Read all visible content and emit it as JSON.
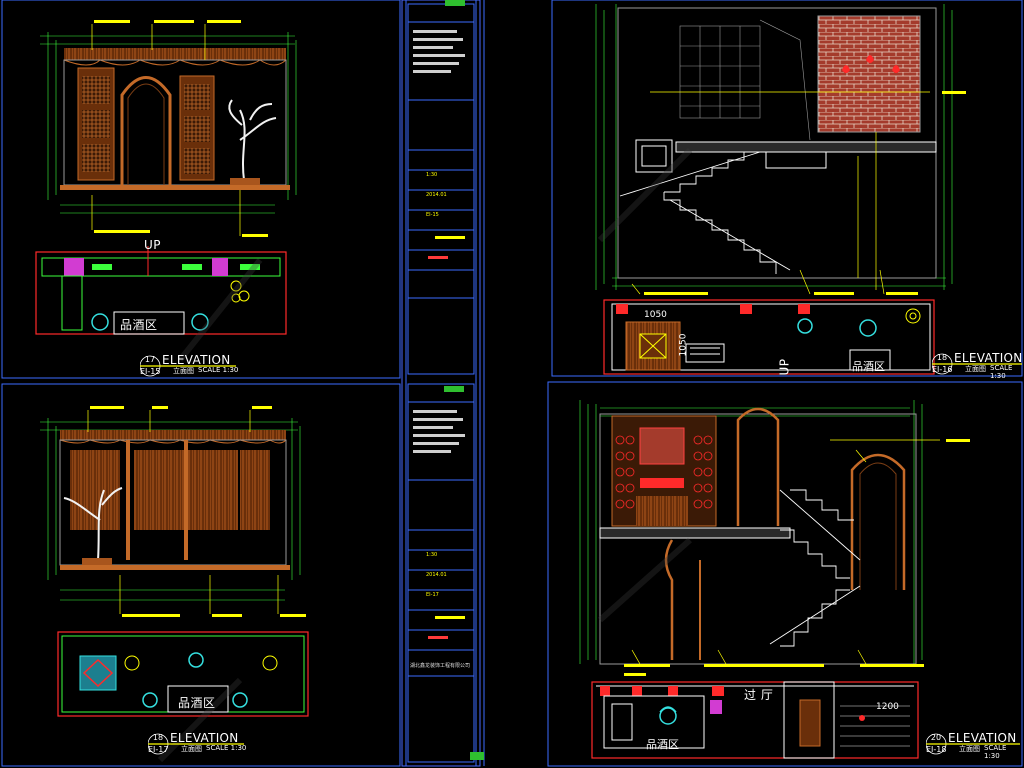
{
  "panels": [
    {
      "id": "tl",
      "up_label": "UP",
      "plan_label": "品酒区",
      "tag": {
        "number": "17",
        "title": "ELEVATION",
        "code": "EI-15",
        "cn": "立面图",
        "scale": "SCALE  1:30"
      }
    },
    {
      "id": "tr",
      "up_label": "UP",
      "plan_label": "品酒区",
      "dim_a": "1050",
      "dim_b": "1050",
      "tag": {
        "number": "18",
        "title": "ELEVATION",
        "code": "EI-16",
        "cn": "立面图",
        "scale": "SCALE  1:30"
      }
    },
    {
      "id": "bl",
      "plan_label": "品酒区",
      "tag": {
        "number": "18",
        "title": "ELEVATION",
        "code": "EI-17",
        "cn": "立面图",
        "scale": "SCALE  1:30"
      }
    },
    {
      "id": "br",
      "plan_label": "品酒区",
      "hall_label": "过 厅",
      "dim_a": "1200",
      "tag": {
        "number": "20",
        "title": "ELEVATION",
        "code": "EI-18",
        "cn": "立面图",
        "scale": "SCALE  1:30"
      }
    }
  ],
  "title_block_top": {
    "company": "",
    "rows": [
      "1:30",
      "2014.01",
      "EI-15"
    ]
  },
  "title_block_bottom": {
    "company": "湖北鑫龙装饰工程有限公司",
    "rows": [
      "1:30",
      "2014.01",
      "EI-17"
    ]
  },
  "colors": {
    "background": "#000000",
    "frame": "#3b6cff",
    "wood": "#b35a1f",
    "yellow": "#ffff00",
    "green": "#3cff3c",
    "red": "#ff2a2a",
    "cyan": "#35e0e0",
    "magenta": "#ff33ff",
    "white": "#ffffff"
  }
}
